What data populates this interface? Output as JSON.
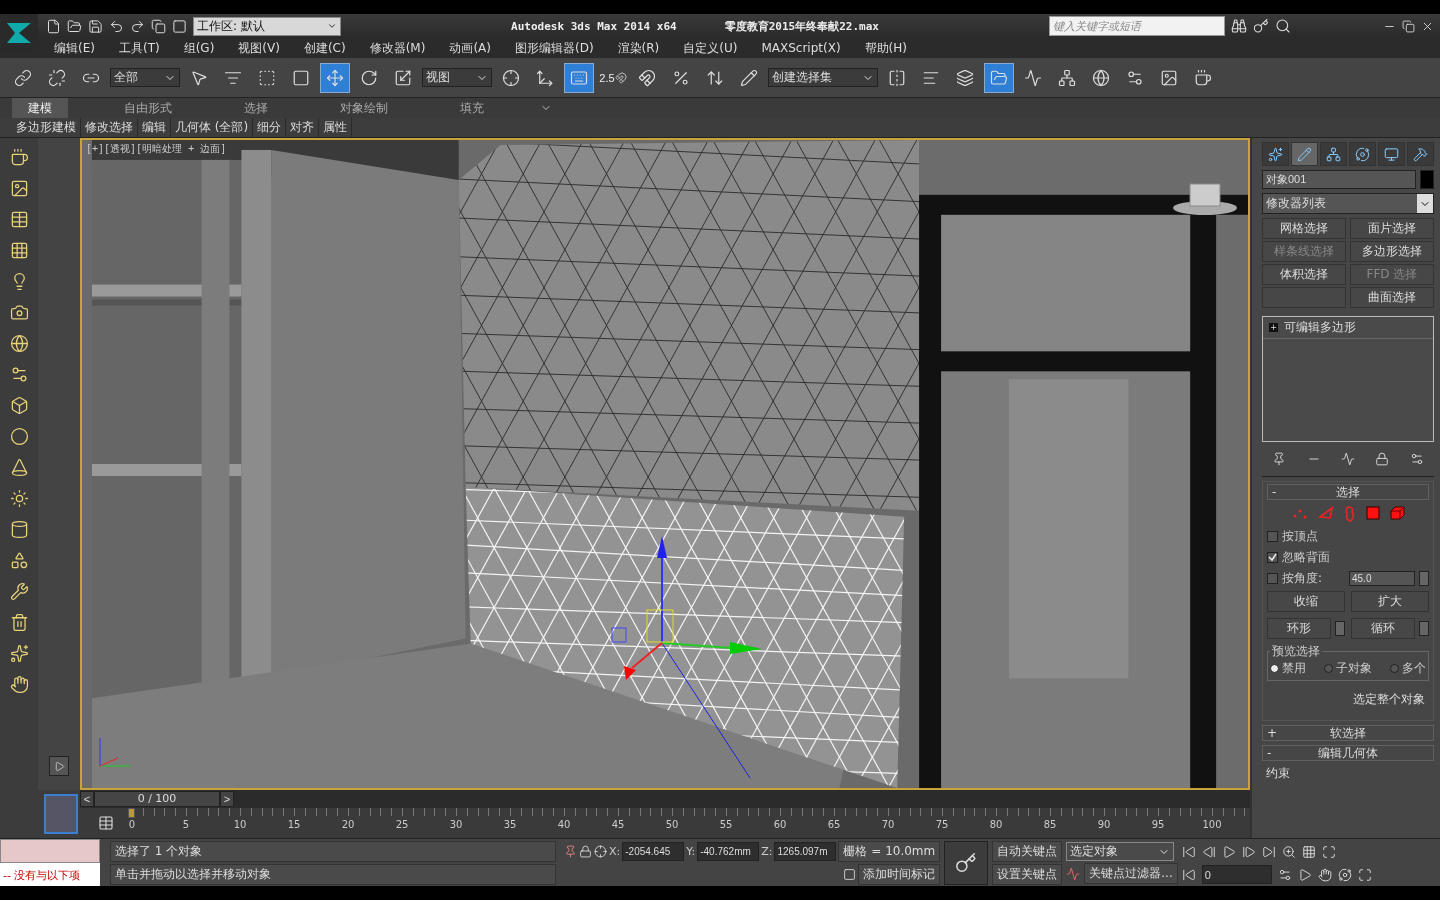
{
  "title_bar": {
    "workspace": "工作区: 默认",
    "app_title": "Autodesk 3ds Max  2014 x64",
    "file_name": "零度教育2015年终奉献22.max",
    "search": {
      "placeholder": "键入关键字或短语"
    }
  },
  "menu": [
    "编辑(E)",
    "工具(T)",
    "组(G)",
    "视图(V)",
    "创建(C)",
    "修改器(M)",
    "动画(A)",
    "图形编辑器(D)",
    "渲染(R)",
    "自定义(U)",
    "MAXScript(X)",
    "帮助(H)"
  ],
  "toolbar": [
    {
      "kind": "link",
      "selected": false
    },
    {
      "kind": "unlink",
      "selected": false
    },
    {
      "kind": "bind",
      "selected": false
    },
    {
      "kind": "dropdown",
      "value": "全部"
    },
    {
      "kind": "select",
      "selected": false
    },
    {
      "kind": "select-by-name",
      "selected": false
    },
    {
      "kind": "region",
      "selected": false
    },
    {
      "kind": "crossing",
      "selected": false
    },
    {
      "kind": "move",
      "selected": true
    },
    {
      "kind": "rotate",
      "selected": false
    },
    {
      "kind": "scale",
      "selected": false
    },
    {
      "kind": "dropdown",
      "value": "视图"
    },
    {
      "kind": "pivot",
      "selected": false
    },
    {
      "kind": "manipulate",
      "selected": false
    },
    {
      "kind": "keyboard",
      "selected": true
    },
    {
      "kind": "snap",
      "label": "2.5",
      "selected": false
    },
    {
      "kind": "angle-snap",
      "selected": false
    },
    {
      "kind": "percent-snap",
      "selected": false
    },
    {
      "kind": "spinner-snap",
      "selected": false
    },
    {
      "kind": "named-sets",
      "selected": false
    },
    {
      "kind": "dropdown",
      "value": "创建选择集"
    },
    {
      "kind": "mirror",
      "selected": false
    },
    {
      "kind": "align",
      "selected": false
    },
    {
      "kind": "layers",
      "selected": false
    },
    {
      "kind": "explorer",
      "selected": true
    },
    {
      "kind": "curve-editor",
      "selected": false
    },
    {
      "kind": "schematic",
      "selected": false
    },
    {
      "kind": "material",
      "selected": false
    },
    {
      "kind": "render-setup",
      "selected": false
    },
    {
      "kind": "frame-window",
      "selected": false
    },
    {
      "kind": "render",
      "selected": false
    }
  ],
  "ribbon": {
    "tabs": [
      {
        "label": "建模",
        "selected": true
      },
      {
        "label": "自由形式",
        "selected": false
      },
      {
        "label": "选择",
        "selected": false
      },
      {
        "label": "对象绘制",
        "selected": false
      },
      {
        "label": "填充",
        "selected": false
      }
    ],
    "panels": [
      "多边形建模",
      "修改选择",
      "编辑",
      "几何体 (全部)",
      "细分",
      "对齐",
      "属性"
    ]
  },
  "viewport": {
    "label": "[+][透视][明暗处理 + 边面]",
    "active": true
  },
  "command_panel": {
    "tabs": [
      {
        "kind": "create",
        "selected": false
      },
      {
        "kind": "modify",
        "selected": true
      },
      {
        "kind": "hierarchy",
        "selected": false
      },
      {
        "kind": "motion",
        "selected": false
      },
      {
        "kind": "display",
        "selected": false
      },
      {
        "kind": "utilities",
        "selected": false
      }
    ],
    "object_name": "对象001",
    "modifier_list": "修改器列表",
    "modifier_buttons": {
      "left": [
        {
          "label": "网格选择",
          "disabled": false
        },
        {
          "label": "样条线选择",
          "disabled": true
        },
        {
          "label": "体积选择",
          "disabled": false
        }
      ],
      "right": [
        {
          "label": "面片选择",
          "disabled": false
        },
        {
          "label": "多边形选择",
          "disabled": false
        },
        {
          "label": "FFD 选择",
          "disabled": true
        },
        {
          "label": "曲面选择",
          "disabled": false
        }
      ]
    },
    "stack": [
      {
        "label": "可编辑多边形",
        "sign": "+"
      }
    ],
    "selection_rollout": {
      "sign": "-",
      "title": "选择",
      "levels": [
        {
          "kind": "vertex"
        },
        {
          "kind": "edge"
        },
        {
          "kind": "border"
        },
        {
          "kind": "polygon"
        },
        {
          "kind": "element"
        }
      ],
      "checks": [
        {
          "label": "按顶点",
          "checked": false
        },
        {
          "label": "忽略背面",
          "checked": true
        },
        {
          "label": "按角度:",
          "checked": false,
          "value": "45.0"
        }
      ],
      "buttons": [
        {
          "label": "收缩",
          "spinner": false
        },
        {
          "label": "扩大",
          "spinner": false
        },
        {
          "label": "环形",
          "spinner": true
        },
        {
          "label": "循环",
          "spinner": true
        }
      ],
      "preview": {
        "title": "预览选择",
        "options": [
          {
            "label": "禁用",
            "selected": true
          },
          {
            "label": "子对象",
            "selected": false
          },
          {
            "label": "多个",
            "selected": false
          }
        ]
      },
      "info": "选定整个对象"
    },
    "rollouts": [
      {
        "sign": "+",
        "title": "软选择"
      },
      {
        "sign": "-",
        "title": "编辑几何体"
      }
    ],
    "constraints_label": "约束"
  },
  "timeline": {
    "position": "0 / 100",
    "prev": "<",
    "next": ">",
    "ticks": [
      "0",
      "5",
      "10",
      "15",
      "20",
      "25",
      "30",
      "35",
      "40",
      "45",
      "50",
      "55",
      "60",
      "65",
      "70",
      "75",
      "80",
      "85",
      "90",
      "95",
      "100"
    ]
  },
  "status": {
    "listener": "-- 没有与以下项",
    "selection": "选择了 1 个对象",
    "prompt": "单击并拖动以选择并移动对象",
    "coords": [
      {
        "axis": "X:",
        "value": "-2054.645"
      },
      {
        "axis": "Y:",
        "value": "-40.762mm"
      },
      {
        "axis": "Z:",
        "value": "1265.097m"
      }
    ],
    "grid": "栅格 = 10.0mm",
    "time_tag": "添加时间标记",
    "auto_key": "自动关键点",
    "set_key": "设置关键点",
    "key_mode": "选定对象",
    "key_filters": "关键点过滤器...",
    "frame": "0"
  }
}
